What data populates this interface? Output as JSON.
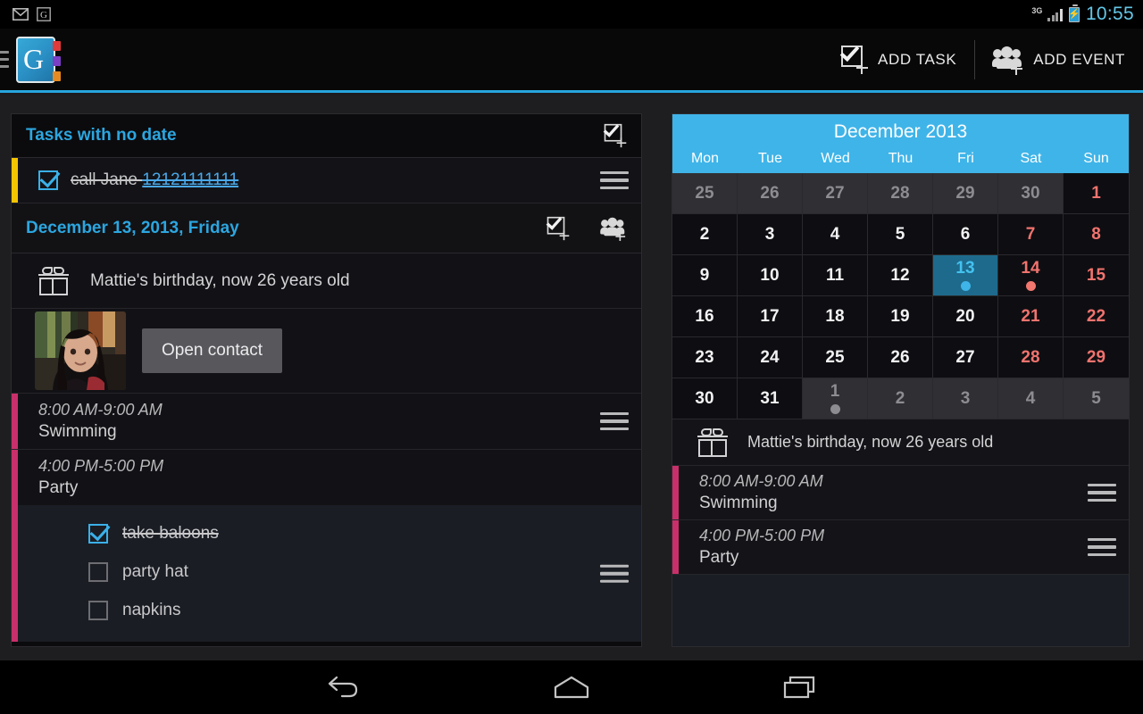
{
  "status_bar": {
    "notif_icons": [
      "gmail-icon",
      "g-app-icon"
    ],
    "network": "3G",
    "battery_state": "charging",
    "time": "10:55"
  },
  "action_bar": {
    "app_icon_letter": "G",
    "add_task_label": "ADD TASK",
    "add_event_label": "ADD EVENT"
  },
  "left_panel": {
    "no_date_section": {
      "title": "Tasks with no date",
      "tasks": [
        {
          "text": "call Jane ",
          "link_text": "12121111111",
          "checked": true,
          "accent": "#f5c400"
        }
      ]
    },
    "day_section": {
      "title": "December 13, 2013, Friday",
      "birthday": "Mattie's birthday, now 26 years old",
      "contact_button": "Open contact",
      "events": [
        {
          "time": "8:00 AM-9:00 AM",
          "title": "Swimming",
          "accent": "#c9306b"
        },
        {
          "time": "4:00 PM-5:00 PM",
          "title": "Party",
          "accent": "#c9306b"
        }
      ],
      "subtasks": [
        {
          "text": "take baloons",
          "checked": true
        },
        {
          "text": "party hat",
          "checked": false
        },
        {
          "text": "napkins",
          "checked": false
        }
      ]
    }
  },
  "right_panel": {
    "calendar": {
      "title": "December 2013",
      "day_names": [
        "Mon",
        "Tue",
        "Wed",
        "Thu",
        "Fri",
        "Sat",
        "Sun"
      ],
      "selected_day": 13,
      "weeks": [
        [
          {
            "d": "25",
            "o": true
          },
          {
            "d": "26",
            "o": true
          },
          {
            "d": "27",
            "o": true
          },
          {
            "d": "28",
            "o": true
          },
          {
            "d": "29",
            "o": true
          },
          {
            "d": "30",
            "o": true
          },
          {
            "d": "1",
            "o": true,
            "w": true
          }
        ],
        [
          {
            "d": "2"
          },
          {
            "d": "3"
          },
          {
            "d": "4"
          },
          {
            "d": "5"
          },
          {
            "d": "6"
          },
          {
            "d": "7",
            "w": true
          },
          {
            "d": "8",
            "w": true
          }
        ],
        [
          {
            "d": "9"
          },
          {
            "d": "10"
          },
          {
            "d": "11"
          },
          {
            "d": "12"
          },
          {
            "d": "13",
            "sel": true,
            "dot": "blue"
          },
          {
            "d": "14",
            "w": true,
            "dot": "red"
          },
          {
            "d": "15",
            "w": true
          }
        ],
        [
          {
            "d": "16"
          },
          {
            "d": "17"
          },
          {
            "d": "18"
          },
          {
            "d": "19"
          },
          {
            "d": "20"
          },
          {
            "d": "21",
            "w": true
          },
          {
            "d": "22",
            "w": true
          }
        ],
        [
          {
            "d": "23"
          },
          {
            "d": "24"
          },
          {
            "d": "25"
          },
          {
            "d": "26"
          },
          {
            "d": "27"
          },
          {
            "d": "28",
            "w": true
          },
          {
            "d": "29",
            "w": true
          }
        ],
        [
          {
            "d": "30"
          },
          {
            "d": "31"
          },
          {
            "d": "1",
            "o": true,
            "g": true,
            "dot": "gray"
          },
          {
            "d": "2",
            "o": true,
            "g": true
          },
          {
            "d": "3",
            "o": true,
            "g": true
          },
          {
            "d": "4",
            "o": true,
            "g": true
          },
          {
            "d": "5",
            "o": true,
            "g": true
          }
        ]
      ]
    },
    "birthday": "Mattie's birthday, now 26 years old",
    "events": [
      {
        "time": "8:00 AM-9:00 AM",
        "title": "Swimming",
        "accent": "#c9306b"
      },
      {
        "time": "4:00 PM-5:00 PM",
        "title": "Party",
        "accent": "#c9306b"
      }
    ]
  },
  "nav_bar": {
    "back": "back-icon",
    "home": "home-icon",
    "recents": "recents-icon"
  },
  "colors": {
    "accent_blue": "#3fb4e8",
    "task_accent": "#f5c400",
    "event_accent": "#c9306b",
    "weekend_red": "#f2736e"
  }
}
